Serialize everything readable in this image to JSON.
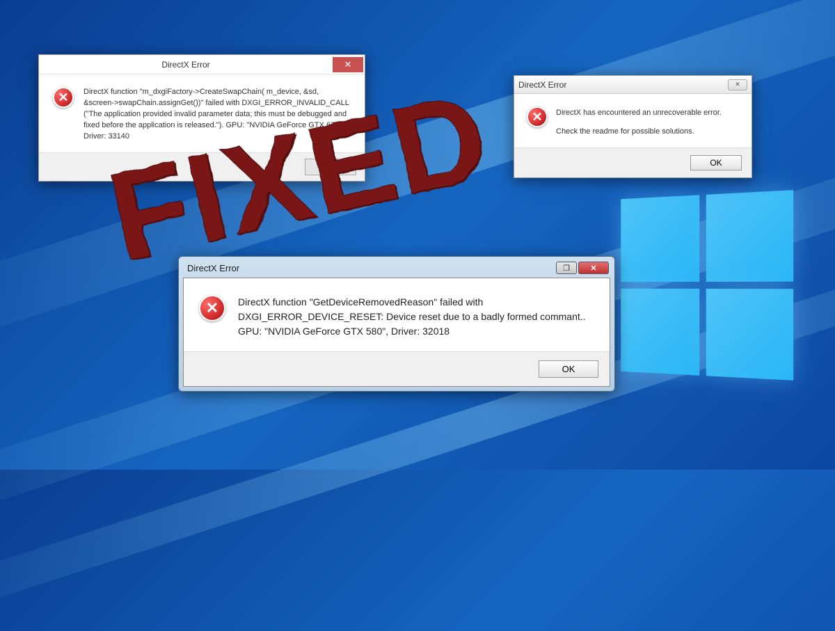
{
  "dialog1": {
    "title": "DirectX Error",
    "message": "DirectX function \"m_dxgiFactory->CreateSwapChain( m_device, &sd, &screen->swapChain.assignGet())\" failed with DXGI_ERROR_INVALID_CALL (\"The application provided invalid parameter data; this must be debugged and fixed before the application is released.\"). GPU: \"NVIDIA GeForce GTX 670\", Driver: 33140",
    "ok_label": "OK",
    "close_glyph": "✕"
  },
  "dialog2": {
    "title": "DirectX Error",
    "line1": "DirectX has encountered an unrecoverable error.",
    "line2": "Check the readme for possible solutions.",
    "ok_label": "OK",
    "close_glyph": "✕"
  },
  "dialog3": {
    "title": "DirectX Error",
    "message": "DirectX function \"GetDeviceRemovedReason\" failed with DXGI_ERROR_DEVICE_RESET: Device reset due to a badly formed commant.. GPU: \"NVIDIA GeForce GTX 580\", Driver: 32018",
    "ok_label": "OK",
    "max_glyph": "❐",
    "close_glyph": "✕"
  },
  "stamp_text": "FIXED",
  "error_glyph": "✕"
}
